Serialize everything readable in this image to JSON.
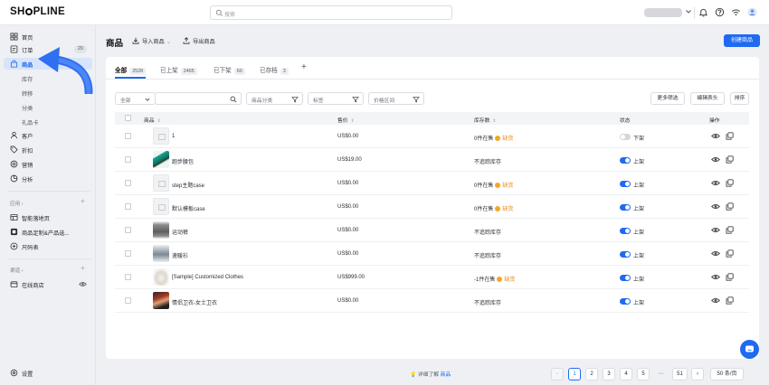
{
  "topbar": {
    "logo_left": "SH",
    "logo_right": "PLINE",
    "search_placeholder": "搜索"
  },
  "sidebar": {
    "items": [
      {
        "label": "首页",
        "icon": "grid-icon"
      },
      {
        "label": "订单",
        "icon": "order-icon",
        "badge": "20"
      },
      {
        "label": "商品",
        "icon": "bag-icon",
        "active": true
      },
      {
        "label": "库存"
      },
      {
        "label": "转移"
      },
      {
        "label": "分类"
      },
      {
        "label": "礼品卡"
      },
      {
        "label": "客户",
        "icon": "user-icon"
      },
      {
        "label": "折扣",
        "icon": "tag-icon"
      },
      {
        "label": "营销",
        "icon": "target-icon"
      },
      {
        "label": "分析",
        "icon": "chart-icon"
      }
    ],
    "apps_head": "应用 ›",
    "apps": [
      {
        "label": "智能落地页"
      },
      {
        "label": "商品定制&产品选..."
      },
      {
        "label": "尺码表"
      }
    ],
    "channels_head": "渠道 ›",
    "channels": [
      {
        "label": "在线商店"
      }
    ],
    "settings_label": "设置"
  },
  "header": {
    "title": "商品",
    "import_label": "导入商品",
    "export_label": "导出商品",
    "create_label": "创建商品"
  },
  "tabs": [
    {
      "label": "全部",
      "count": "2528"
    },
    {
      "label": "已上架",
      "count": "2465"
    },
    {
      "label": "已下架",
      "count": "60"
    },
    {
      "label": "已存档",
      "count": "3"
    }
  ],
  "filters": {
    "scope_select": "全部",
    "category": "商品分类",
    "tags": "标签",
    "price_range": "价格区间",
    "more_filters": "更多筛选",
    "edit_columns": "编辑表头",
    "sort": "排序"
  },
  "table": {
    "columns": [
      "商品",
      "售价",
      "库存数",
      "状态",
      "操作"
    ],
    "rows": [
      {
        "name": "1",
        "price": "US$0.00",
        "stock": "0件在售",
        "warn": "缺货",
        "status": "下架",
        "on": false
      },
      {
        "name": "跑步腰包",
        "price": "US$19.00",
        "stock": "不追踪库存",
        "warn": "",
        "status": "上架",
        "on": true
      },
      {
        "name": "step主题case",
        "price": "US$0.00",
        "stock": "0件在售",
        "warn": "缺货",
        "status": "上架",
        "on": true
      },
      {
        "name": "默认模板case",
        "price": "US$0.00",
        "stock": "0件在售",
        "warn": "缺货",
        "status": "上架",
        "on": true
      },
      {
        "name": "运动裤",
        "price": "US$0.00",
        "stock": "不追踪库存",
        "warn": "",
        "status": "上架",
        "on": true
      },
      {
        "name": "速暖衫",
        "price": "US$0.00",
        "stock": "不追踪库存",
        "warn": "",
        "status": "上架",
        "on": true
      },
      {
        "name": "[Sample] Customized Clothes",
        "price": "US$999.00",
        "stock": "-1件在售",
        "warn": "缺货",
        "status": "上架",
        "on": true
      },
      {
        "name": "情侣卫衣-女士卫衣",
        "price": "US$0.00",
        "stock": "不追踪库存",
        "warn": "",
        "status": "上架",
        "on": true
      }
    ]
  },
  "pagination": {
    "pages": [
      "1",
      "2",
      "3",
      "4",
      "5"
    ],
    "last": "51",
    "dots": "···",
    "per_page": "50 条/页"
  },
  "footer": {
    "help_text": "详细了解",
    "help_link": "商品"
  },
  "colors": {
    "accent": "#1f6af0",
    "warning": "#f5a623"
  }
}
